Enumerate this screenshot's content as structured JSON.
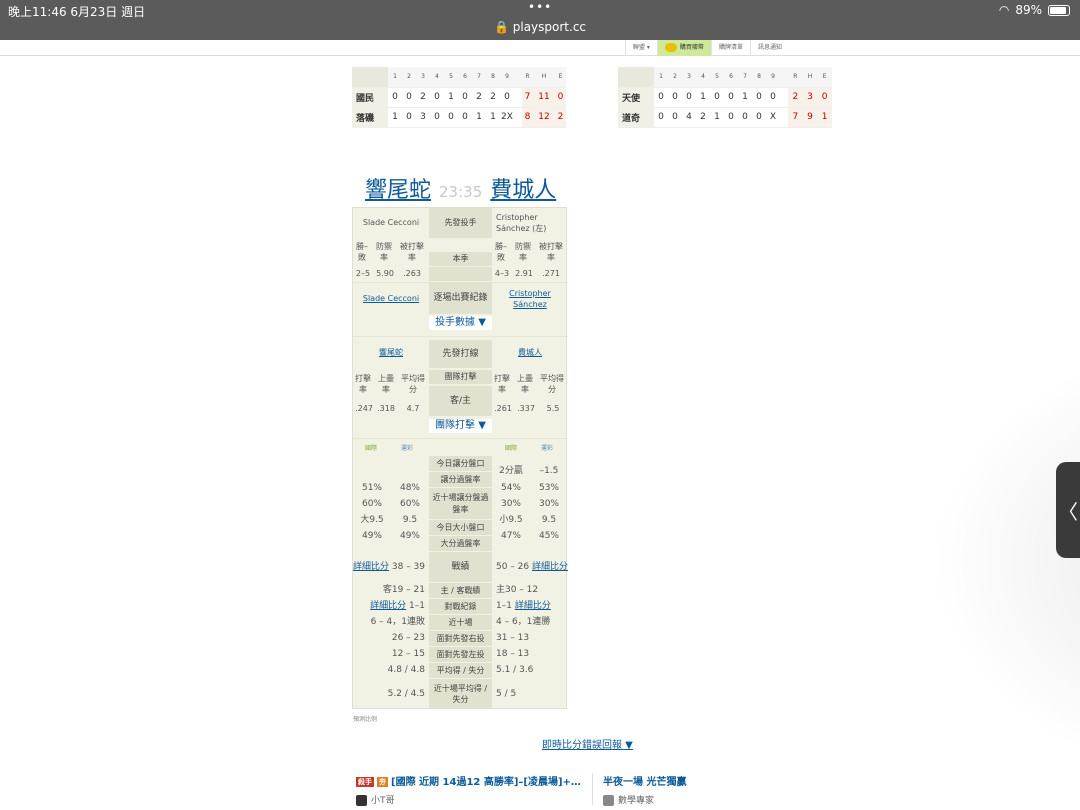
{
  "status": {
    "time": "晚上11:46 6月23日 週日",
    "dots": "•••",
    "url": "playsport.cc",
    "battery": "89%"
  },
  "topnav": [
    "聯盟 ▾",
    "購買噱幣",
    "購牌清單",
    "訊息通知"
  ],
  "scoreboards": [
    {
      "innings": [
        "1",
        "2",
        "3",
        "4",
        "5",
        "6",
        "7",
        "8",
        "9"
      ],
      "rhe_headers": [
        "R",
        "H",
        "E"
      ],
      "rows": [
        {
          "team": "國民",
          "innings": [
            "0",
            "0",
            "2",
            "0",
            "1",
            "0",
            "2",
            "2",
            "0"
          ],
          "rhe": [
            "7",
            "11",
            "0"
          ]
        },
        {
          "team": "落磯",
          "innings": [
            "1",
            "0",
            "3",
            "0",
            "0",
            "0",
            "1",
            "1",
            "2X"
          ],
          "rhe": [
            "8",
            "12",
            "2"
          ]
        }
      ]
    },
    {
      "innings": [
        "1",
        "2",
        "3",
        "4",
        "5",
        "6",
        "7",
        "8",
        "9"
      ],
      "rhe_headers": [
        "R",
        "H",
        "E"
      ],
      "rows": [
        {
          "team": "天使",
          "innings": [
            "0",
            "0",
            "0",
            "1",
            "0",
            "0",
            "1",
            "0",
            "0"
          ],
          "rhe": [
            "2",
            "3",
            "0"
          ]
        },
        {
          "team": "道奇",
          "innings": [
            "0",
            "0",
            "4",
            "2",
            "1",
            "0",
            "0",
            "0",
            "X"
          ],
          "rhe": [
            "7",
            "9",
            "1"
          ]
        }
      ]
    }
  ],
  "match": {
    "away": "響尾蛇",
    "time": "23:35",
    "home": "費城人"
  },
  "mt": {
    "pitchers": {
      "away": "Slade Cecconi",
      "label": "先發投手",
      "home": "Cristopher Sánchez (左)"
    },
    "stat_heads": [
      "勝–敗",
      "防禦率",
      "被打擊率"
    ],
    "season_label": "本季",
    "away_stats": [
      "2–5",
      "5.90",
      ".263"
    ],
    "home_stats": [
      "4–3",
      "2.91",
      ".271"
    ],
    "venue_label": "逐場出賽紀錄",
    "away_link": "Slade Cecconi",
    "home_link": "Cristopher Sánchez",
    "pitch_toggle": "投手數據 ▼",
    "lineup": {
      "away": "響尾蛇",
      "label": "先發打線",
      "home": "費城人"
    },
    "bat_heads": [
      "打擊率",
      "上壘率",
      "平均得分"
    ],
    "team_bat_label": "團隊打擊",
    "homeaway_label": "客/主",
    "away_bat": [
      ".247",
      ".318",
      "4.7"
    ],
    "home_bat": [
      ".261",
      ".337",
      "5.5"
    ],
    "bat_toggle": "團隊打擊 ▼",
    "mini": {
      "a": "國際",
      "b": "運彩"
    },
    "odds_labels": [
      "今日讓分盤口",
      "讓分過盤率",
      "近十場讓分盤過盤率",
      "今日大小盤口",
      "大分過盤率"
    ],
    "home_line": [
      "2分贏",
      "–1.5"
    ],
    "away_odds": [
      [
        "51%",
        "48%"
      ],
      [
        "60%",
        "60%"
      ],
      [
        "大9.5",
        "9.5"
      ],
      [
        "49%",
        "49%"
      ]
    ],
    "home_odds": [
      [
        "54%",
        "53%"
      ],
      [
        "30%",
        "30%"
      ],
      [
        "小9.5",
        "9.5"
      ],
      [
        "47%",
        "45%"
      ]
    ],
    "record": {
      "label": "戰績",
      "away_link": "詳細比分",
      "away": "38 – 39",
      "home": "50 – 26",
      "home_link": "詳細比分"
    },
    "rows": [
      {
        "label": "主 / 客戰績",
        "away": "客19 – 21",
        "home": "主30 – 12"
      },
      {
        "label": "對戰紀錄",
        "away_link": "詳細比分",
        "away": "1–1",
        "home": "1–1",
        "home_link": "詳細比分"
      },
      {
        "label": "近十場",
        "away": "6 – 4，1連敗",
        "home": "4 – 6，1連勝"
      },
      {
        "label": "面對先發右投",
        "away": "26 – 23",
        "home": "31 – 13"
      },
      {
        "label": "面對先發左投",
        "away": "12 – 15",
        "home": "18 – 13"
      },
      {
        "label": "平均得 / 失分",
        "away": "4.8 / 4.8",
        "home": "5.1 / 3.6"
      },
      {
        "label": "近十場平均得 / 失分",
        "away": "5.2 / 4.5",
        "home": "5 / 5"
      }
    ]
  },
  "footnote": "預測比例",
  "report": "即時比分錯誤回報 ▼",
  "bottom": {
    "tag1": "殺手",
    "tag2": "夯",
    "post1": "[國際 近期 14過12 高勝率]–[凌晨場]+…",
    "user1": "小T哥",
    "post2": "半夜一場 光芒獨贏",
    "user2": "數學專家"
  },
  "side": "〈"
}
